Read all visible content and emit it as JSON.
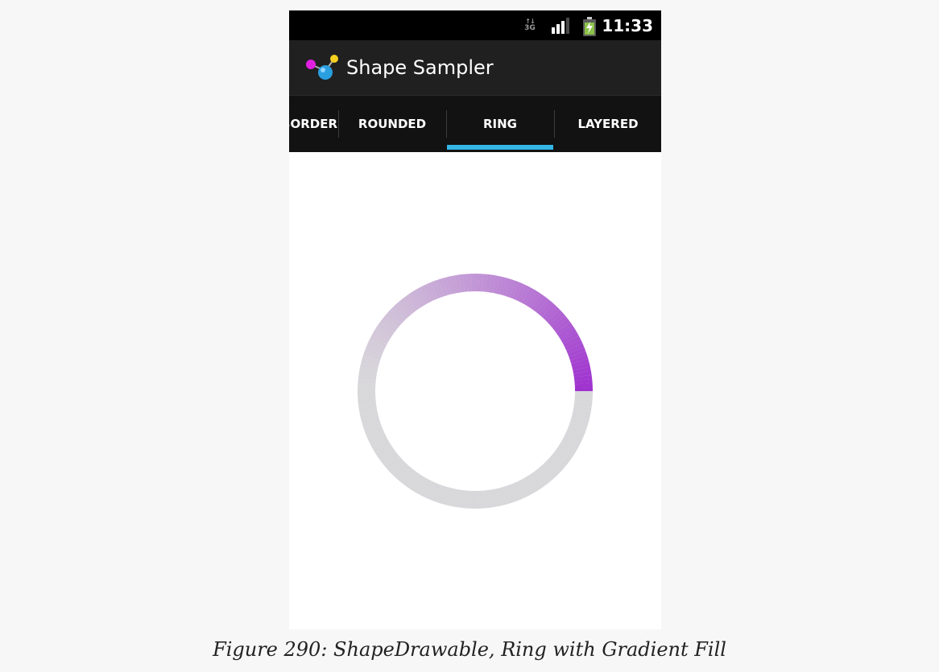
{
  "status_bar": {
    "network": "3G",
    "time": "11:33",
    "icons": [
      "network-3g-icon",
      "signal-strength-icon",
      "battery-charging-icon"
    ]
  },
  "action_bar": {
    "icon": "shape-sampler-app-icon",
    "title": "Shape Sampler"
  },
  "tabs": [
    {
      "label": "BORDER",
      "selected": false
    },
    {
      "label": "ROUNDED",
      "selected": false
    },
    {
      "label": "RING",
      "selected": true
    },
    {
      "label": "LAYERED",
      "selected": false
    }
  ],
  "ring": {
    "gradient_start_color": "#d8d7da",
    "gradient_end_color": "#9e2fcf"
  },
  "colors": {
    "tab_indicator": "#33b5e5",
    "status_bar": "#000000",
    "action_bar": "#202020",
    "tab_bar": "#121212"
  },
  "caption": "Figure 290: ShapeDrawable, Ring with Gradient Fill"
}
